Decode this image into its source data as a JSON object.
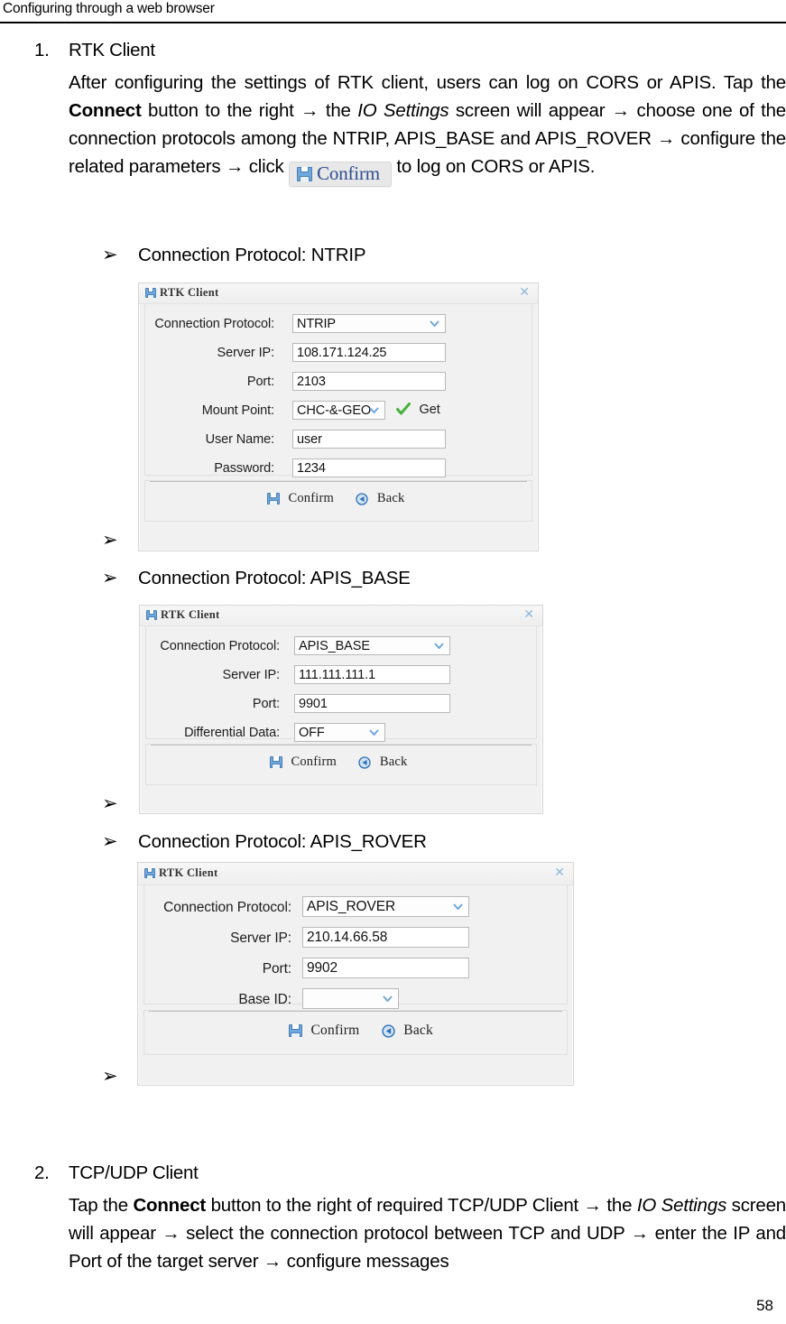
{
  "header": {
    "running_head": "Configuring through a web browser"
  },
  "page_number": "58",
  "sections": [
    {
      "number": "1.",
      "title": "RTK Client",
      "paragraph_parts": [
        {
          "text": "After configuring the settings of RTK client, users can log on CORS or APIS. Tap the ",
          "style": "normal"
        },
        {
          "text": "Connect",
          "style": "bold"
        },
        {
          "text": " button to the right → the ",
          "style": "normal"
        },
        {
          "text": "IO Settings",
          "style": "italic"
        },
        {
          "text": " screen will appear → choose one of the connection protocols among the NTRIP, APIS_BASE and APIS_ROVER → configure the related parameters → click ",
          "style": "normal"
        },
        {
          "text": "__CONFIRM_BUTTON__",
          "style": "inline-image"
        },
        {
          "text": " to log on CORS or APIS.",
          "style": "normal"
        }
      ]
    },
    {
      "number": "2.",
      "title": "TCP/UDP Client",
      "paragraph_parts": [
        {
          "text": "Tap the ",
          "style": "normal"
        },
        {
          "text": "Connect",
          "style": "bold"
        },
        {
          "text": " button to the right of required TCP/UDP Client → the ",
          "style": "normal"
        },
        {
          "text": "IO Settings",
          "style": "italic"
        },
        {
          "text": " screen will appear → select the connection protocol between TCP and UDP → enter the IP and Port of the target server → configure messages",
          "style": "normal"
        }
      ]
    }
  ],
  "inline_confirm_button": {
    "label": "Confirm",
    "icon": "floppy-save-icon",
    "text_color": "#2d4e8f",
    "background": "#e8e8e8"
  },
  "bullets": [
    {
      "label": "Connection Protocol: NTRIP",
      "marker": "➢"
    },
    {
      "label": "Connection Protocol: APIS_BASE",
      "marker": "➢"
    },
    {
      "label": "Connection Protocol: APIS_ROVER",
      "marker": "➢"
    },
    {
      "label": "",
      "marker": "➢"
    },
    {
      "label": "",
      "marker": "➢"
    },
    {
      "label": "",
      "marker": "➢"
    }
  ],
  "dialogs": [
    {
      "id": "ntrip",
      "title": "RTK Client",
      "title_icon": "floppy-save-icon",
      "close_icon": "close-icon",
      "fields": [
        {
          "label": "Connection Protocol:",
          "type": "select",
          "value": "NTRIP"
        },
        {
          "label": "Server IP:",
          "type": "input",
          "value": "108.171.124.25"
        },
        {
          "label": "Port:",
          "type": "input",
          "value": "2103"
        },
        {
          "label": "Mount Point:",
          "type": "select",
          "value": "CHC-&-GEO",
          "extra_button": {
            "label": "Get",
            "icon": "green-check-icon"
          }
        },
        {
          "label": "User Name:",
          "type": "input",
          "value": "user"
        },
        {
          "label": "Password:",
          "type": "input",
          "value": "1234"
        }
      ],
      "buttons": [
        {
          "label": "Confirm",
          "icon": "floppy-save-icon"
        },
        {
          "label": "Back",
          "icon": "back-arrow-icon"
        }
      ]
    },
    {
      "id": "apis_base",
      "title": "RTK Client",
      "title_icon": "floppy-save-icon",
      "close_icon": "close-icon",
      "fields": [
        {
          "label": "Connection Protocol:",
          "type": "select",
          "value": "APIS_BASE"
        },
        {
          "label": "Server IP:",
          "type": "input",
          "value": "111.111.111.1"
        },
        {
          "label": "Port:",
          "type": "input",
          "value": "9901"
        },
        {
          "label": "Differential Data:",
          "type": "select",
          "value": "OFF"
        }
      ],
      "buttons": [
        {
          "label": "Confirm",
          "icon": "floppy-save-icon"
        },
        {
          "label": "Back",
          "icon": "back-arrow-icon"
        }
      ]
    },
    {
      "id": "apis_rover",
      "title": "RTK Client",
      "title_icon": "floppy-save-icon",
      "close_icon": "close-icon",
      "fields": [
        {
          "label": "Connection Protocol:",
          "type": "select",
          "value": "APIS_ROVER"
        },
        {
          "label": "Server IP:",
          "type": "input",
          "value": "210.14.66.58"
        },
        {
          "label": "Port:",
          "type": "input",
          "value": "9902"
        },
        {
          "label": "Base ID:",
          "type": "select",
          "value": ""
        }
      ],
      "buttons": [
        {
          "label": "Confirm",
          "icon": "floppy-save-icon"
        },
        {
          "label": "Back",
          "icon": "back-arrow-icon"
        }
      ]
    }
  ]
}
